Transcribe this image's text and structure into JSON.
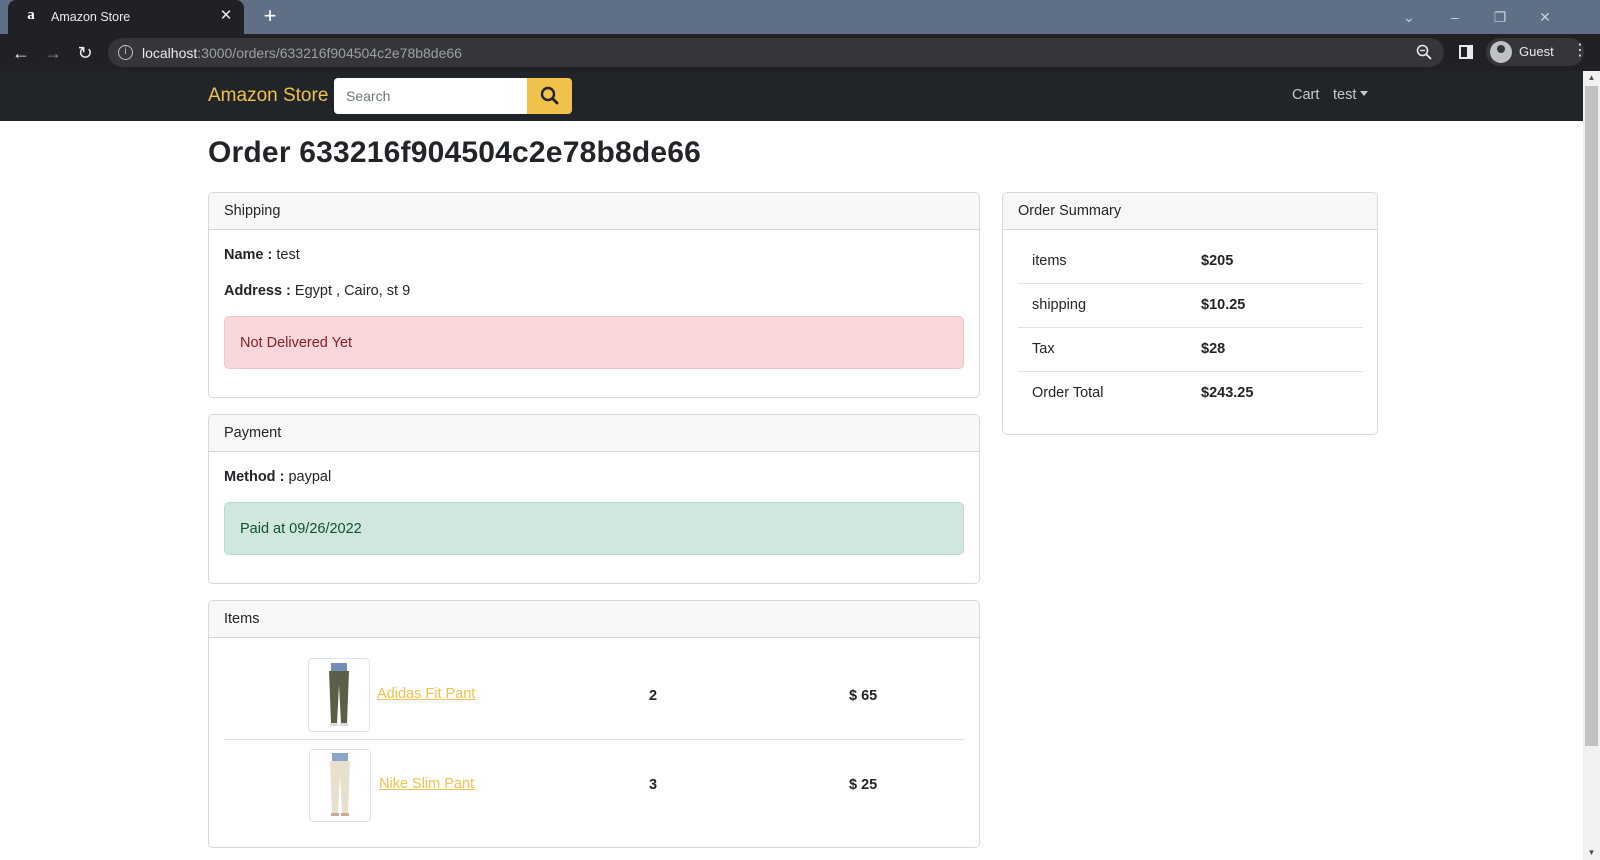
{
  "browser": {
    "tab_title": "Amazon Store",
    "tab_favicon": "amazon-a-icon",
    "url_host": "localhost",
    "url_path": ":3000/orders/633216f904504c2e78b8de66",
    "profile_label": "Guest"
  },
  "nav": {
    "brand": "Amazon Store",
    "search_placeholder": "Search",
    "cart_label": "Cart",
    "user_label": "test"
  },
  "page": {
    "title": "Order 633216f904504c2e78b8de66"
  },
  "shipping": {
    "header": "Shipping",
    "name_label": "Name :",
    "name_value": "test",
    "address_label": "Address :",
    "address_value": "Egypt , Cairo, st 9",
    "status": "Not Delivered Yet"
  },
  "payment": {
    "header": "Payment",
    "method_label": "Method :",
    "method_value": "paypal",
    "status": "Paid at 09/26/2022"
  },
  "items": {
    "header": "Items",
    "rows": [
      {
        "name": "Adidas Fit Pant",
        "quantity": "2",
        "price": "$ 65",
        "image": "olive pants photo"
      },
      {
        "name": "Nike Slim Pant",
        "quantity": "3",
        "price": "$ 25",
        "image": "beige pants photo"
      }
    ]
  },
  "summary": {
    "header": "Order Summary",
    "rows": [
      {
        "label": "items",
        "value": "$205"
      },
      {
        "label": "shipping",
        "value": "$10.25"
      },
      {
        "label": "Tax",
        "value": "$28"
      },
      {
        "label": "Order Total",
        "value": "$243.25"
      }
    ]
  },
  "colors": {
    "navbar_bg": "#212529",
    "brand_accent": "#f0c14b",
    "danger_bg": "#f8d7da",
    "success_bg": "#d1e7dd"
  }
}
